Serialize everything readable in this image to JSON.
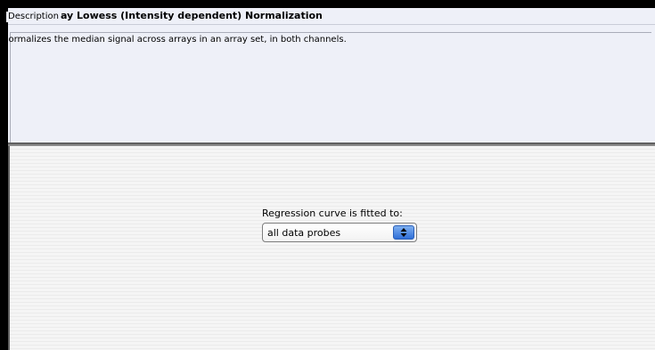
{
  "header": {
    "title": "Intra-Array Lowess (Intensity dependent) Normalization"
  },
  "description": {
    "legend": "Description",
    "text": "Normalizes the median signal across arrays in an array set, in both channels."
  },
  "options": {
    "regression_label": "Regression curve is fitted to:",
    "regression_value": "all data probes"
  },
  "icons": {
    "select_arrows": "up-down-arrows-icon"
  }
}
